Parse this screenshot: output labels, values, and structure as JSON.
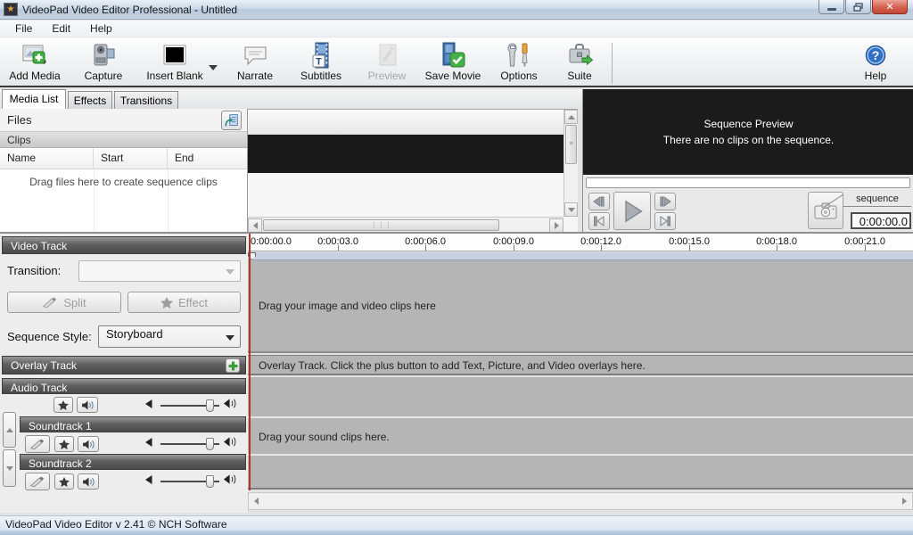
{
  "window": {
    "title": "VideoPad Video Editor Professional - Untitled",
    "app_icon": "videopad-star-icon"
  },
  "menu": {
    "items": [
      "File",
      "Edit",
      "Help"
    ]
  },
  "toolbar": {
    "buttons": [
      {
        "label": "Add Media",
        "icon": "add-media-icon",
        "disabled": false
      },
      {
        "label": "Capture",
        "icon": "capture-icon",
        "disabled": false
      },
      {
        "label": "Insert Blank",
        "icon": "insert-blank-icon",
        "disabled": false,
        "has_dropdown": true
      },
      {
        "label": "Narrate",
        "icon": "narrate-icon",
        "disabled": false
      },
      {
        "label": "Subtitles",
        "icon": "subtitles-icon",
        "disabled": false
      },
      {
        "label": "Preview",
        "icon": "preview-icon",
        "disabled": true
      },
      {
        "label": "Save Movie",
        "icon": "save-movie-icon",
        "disabled": false
      },
      {
        "label": "Options",
        "icon": "options-icon",
        "disabled": false
      },
      {
        "label": "Suite",
        "icon": "suite-icon",
        "disabled": false
      }
    ],
    "help": {
      "label": "Help",
      "icon": "help-icon"
    }
  },
  "tabs": [
    {
      "label": "Media List",
      "active": true
    },
    {
      "label": "Effects",
      "active": false
    },
    {
      "label": "Transitions",
      "active": false
    }
  ],
  "media_panel": {
    "files_title": "Files",
    "detach_icon": "detach-panel-icon",
    "clips_title": "Clips",
    "columns": [
      "Name",
      "Start",
      "End"
    ],
    "empty_text": "Drag files here to create sequence clips"
  },
  "sequence_preview": {
    "title": "Sequence Preview",
    "message": "There are no clips on the sequence.",
    "tab_label": "sequence",
    "time_display": "0:00:00.0",
    "transport_icons": [
      "previous-frame-icon",
      "go-to-start-icon",
      "play-icon",
      "next-frame-icon",
      "go-to-end-icon"
    ],
    "snapshot_icon": "snapshot-camera-icon"
  },
  "video_track_panel": {
    "title": "Video Track",
    "transition_label": "Transition:",
    "transition_value": "",
    "split_label": "Split",
    "effect_label": "Effect",
    "sequence_style_label": "Sequence Style:",
    "sequence_style_value": "Storyboard"
  },
  "overlay_track_panel": {
    "title": "Overlay Track",
    "add_icon": "add-overlay-icon"
  },
  "audio_track_panel": {
    "title": "Audio Track"
  },
  "soundtrack_panels": [
    {
      "title": "Soundtrack 1"
    },
    {
      "title": "Soundtrack 2"
    }
  ],
  "timeline": {
    "ruler_labels": [
      "0:00:00.0",
      "0:00:03.0",
      "0:00:06.0",
      "0:00:09.0",
      "0:00:12.0",
      "0:00:15.0",
      "0:00:18.0",
      "0:00:21.0"
    ],
    "video_hint": "Drag your image and video clips here",
    "overlay_hint": "Overlay Track. Click the plus button to add Text, Picture, and Video overlays here.",
    "audio_hint": "Drag your sound clips here."
  },
  "status_bar": {
    "text": "VideoPad Video Editor v 2.41 © NCH Software"
  },
  "colors": {
    "playhead_red": "#b2352a",
    "track_gray": "#b5b5b5",
    "header_dark": "#555555",
    "titlebar_blue": "#c6d4e4",
    "preview_black": "#1b1b1b",
    "accent_green": "#3fae3f",
    "film_blue": "#3f6fae"
  }
}
